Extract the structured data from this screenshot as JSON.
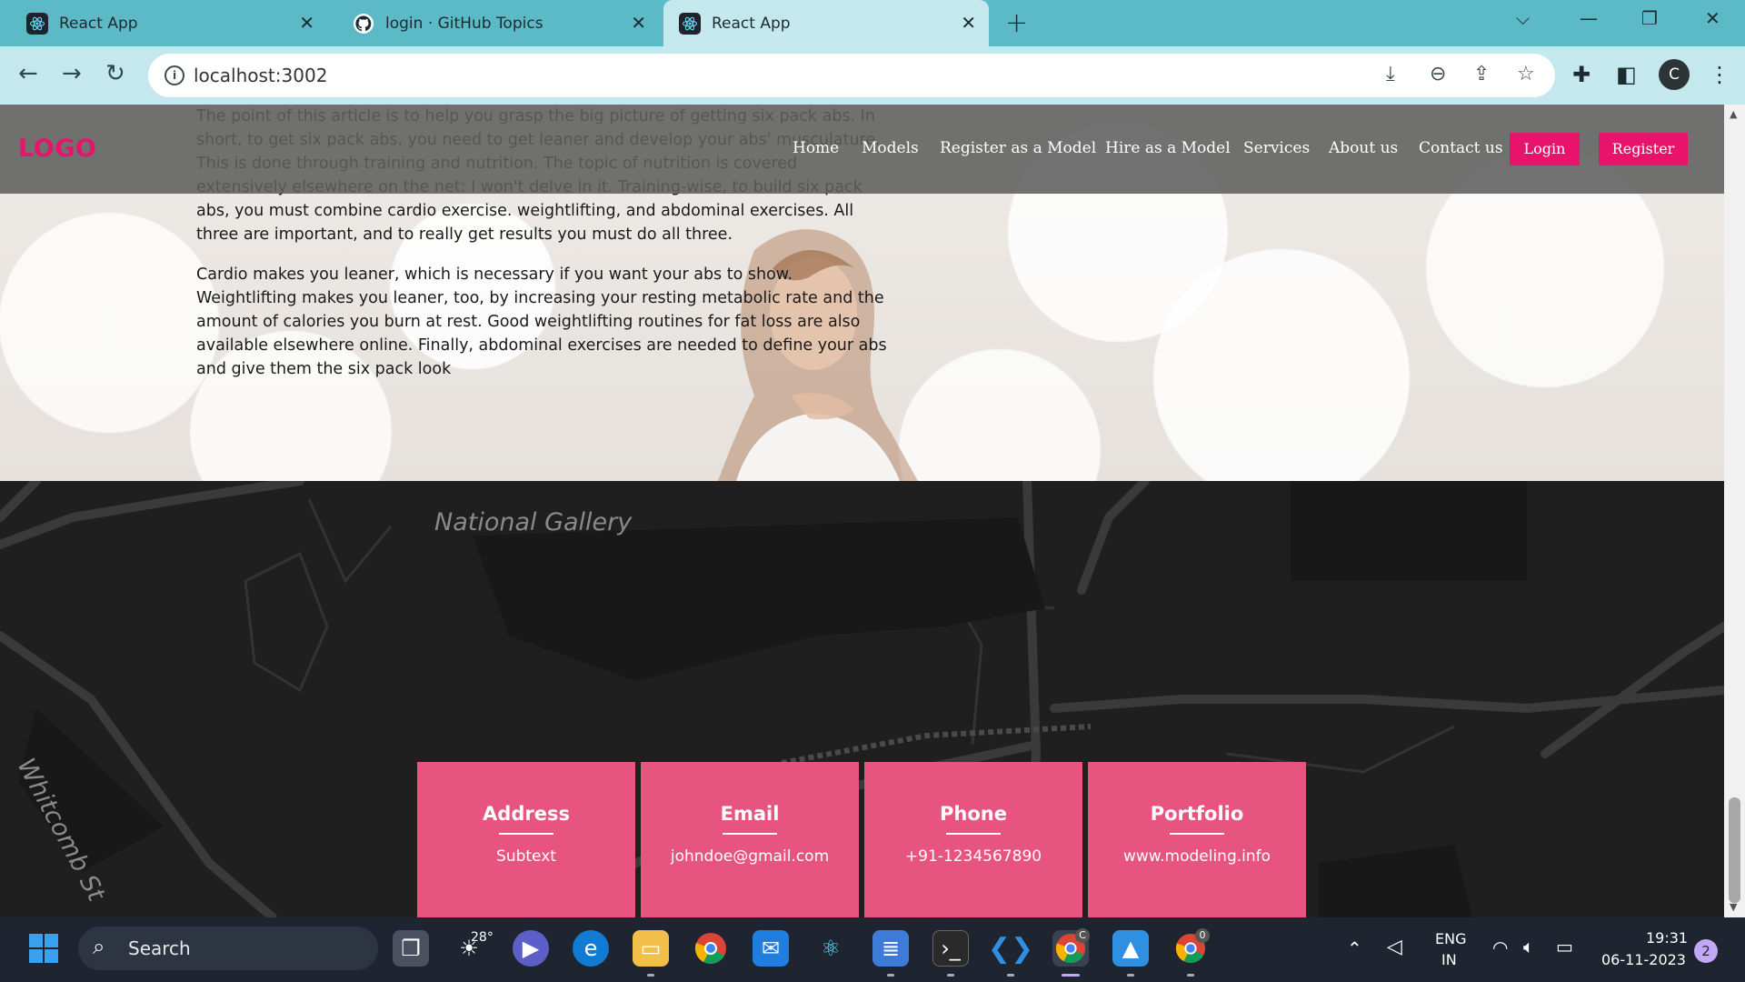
{
  "browser": {
    "tabs": [
      {
        "title": "React App"
      },
      {
        "title": "login · GitHub Topics"
      },
      {
        "title": "React App"
      }
    ],
    "url": "localhost:3002"
  },
  "navbar": {
    "logo": "LOGO",
    "links": [
      "Home",
      "Models",
      "Register as a Model",
      "Hire as a Model",
      "Services",
      "About us",
      "Contact us"
    ],
    "login_label": "Login",
    "register_label": "Register"
  },
  "hero": {
    "paragraph1": "The point of this article is to help you grasp the big picture of getting six pack abs. In short, to get six pack abs, you need to get leaner and develop your abs' musculature. This is done through training and nutrition. The topic of nutrition is covered extensively elsewhere on the net: I won't delve in it. Training-wise, to build six pack abs, you must combine cardio exercise. weightlifting, and abdominal exercises. All three are important, and to really get results you must do all three.",
    "paragraph2": "Cardio makes you leaner, which is necessary if you want your abs to show. Weightlifting makes you leaner, too, by increasing your resting metabolic rate and the amount of calories you burn at rest. Good weightlifting routines for fat loss are also available elsewhere online. Finally, abdominal exercises are needed to define your abs and give them the six pack look"
  },
  "map": {
    "labels": [
      "National Gallery",
      "Whitcomb St"
    ]
  },
  "contact_cards": [
    {
      "title": "Address",
      "value": "Subtext"
    },
    {
      "title": "Email",
      "value": "johndoe@gmail.com"
    },
    {
      "title": "Phone",
      "value": "+91-1234567890"
    },
    {
      "title": "Portfolio",
      "value": "www.modeling.info"
    }
  ],
  "taskbar": {
    "search_label": "Search",
    "weather_temp": "28°",
    "language": "ENG",
    "region": "IN",
    "time": "19:31",
    "date": "06-11-2023",
    "notification_count": "2",
    "profile_initial": "C",
    "chrome_badge": "C",
    "chrome_badge_2": "0"
  },
  "colors": {
    "accent_pink": "#e8136b",
    "card_pink": "#e75480",
    "tabbar": "#5cb9c6",
    "map_bg": "#1f1f1f"
  }
}
